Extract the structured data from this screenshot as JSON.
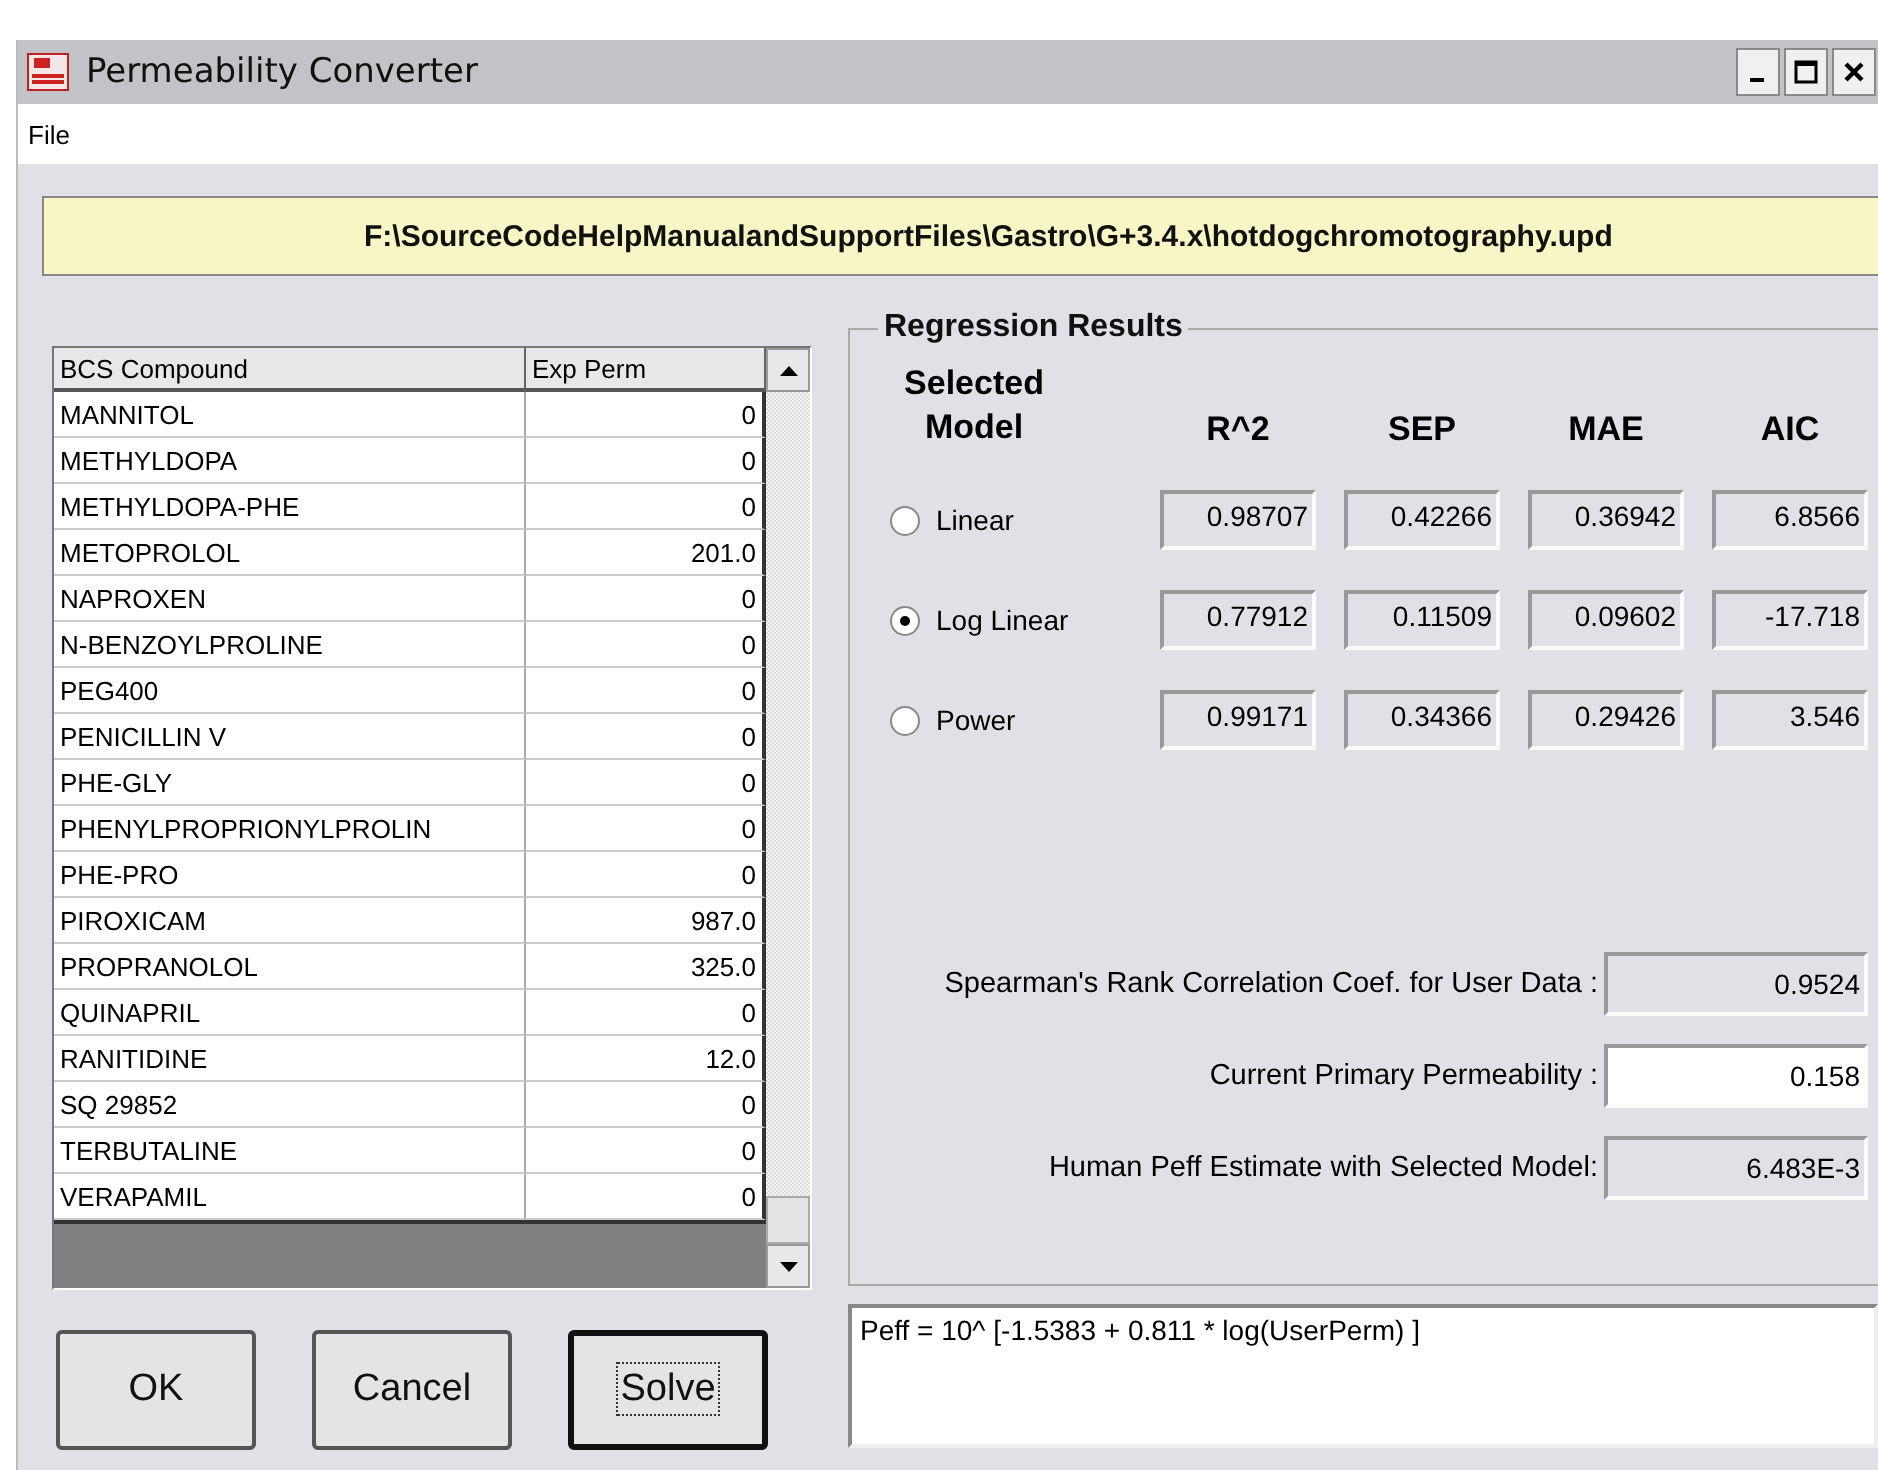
{
  "window": {
    "title": "Permeability Converter"
  },
  "menu": [
    "File"
  ],
  "file_path": "F:\\SourceCodeHelpManualandSupportFiles\\Gastro\\G+3.4.x\\hotdogchromotography.upd",
  "table": {
    "columns": [
      "BCS Compound",
      "Exp Perm"
    ],
    "rows": [
      [
        "MANNITOL",
        "0"
      ],
      [
        "METHYLDOPA",
        "0"
      ],
      [
        "METHYLDOPA-PHE",
        "0"
      ],
      [
        "METOPROLOL",
        "201.0"
      ],
      [
        "NAPROXEN",
        "0"
      ],
      [
        "N-BENZOYLPROLINE",
        "0"
      ],
      [
        "PEG400",
        "0"
      ],
      [
        "PENICILLIN V",
        "0"
      ],
      [
        "PHE-GLY",
        "0"
      ],
      [
        "PHENYLPROPRIONYLPROLIN",
        "0"
      ],
      [
        "PHE-PRO",
        "0"
      ],
      [
        "PIROXICAM",
        "987.0"
      ],
      [
        "PROPRANOLOL",
        "325.0"
      ],
      [
        "QUINAPRIL",
        "0"
      ],
      [
        "RANITIDINE",
        "12.0"
      ],
      [
        "SQ 29852",
        "0"
      ],
      [
        "TERBUTALINE",
        "0"
      ],
      [
        "VERAPAMIL",
        "0"
      ]
    ]
  },
  "regression": {
    "title": "Regression Results",
    "model_header": "Selected Model",
    "columns": [
      "R^2",
      "SEP",
      "MAE",
      "AIC"
    ],
    "models": [
      {
        "label": "Linear",
        "selected": false,
        "values": [
          "0.98707",
          "0.42266",
          "0.36942",
          "6.8566"
        ]
      },
      {
        "label": "Log Linear",
        "selected": true,
        "values": [
          "0.77912",
          "0.11509",
          "0.09602",
          "-17.718"
        ]
      },
      {
        "label": "Power",
        "selected": false,
        "values": [
          "0.99171",
          "0.34366",
          "0.29426",
          "3.546"
        ]
      }
    ],
    "fields": [
      {
        "label": "Spearman's Rank Correlation Coef. for User Data :",
        "value": "0.9524",
        "editable": false
      },
      {
        "label": "Current Primary Permeability :",
        "value": "0.158",
        "editable": true
      },
      {
        "label": "Human Peff Estimate with Selected Model:",
        "value": "6.483E-3",
        "editable": false
      }
    ]
  },
  "buttons": [
    {
      "label": "OK",
      "default": false
    },
    {
      "label": "Cancel",
      "default": false
    },
    {
      "label": "Solve",
      "default": true
    }
  ],
  "formula": "Peff = 10^ [-1.5383 + 0.811 * log(UserPerm) ]"
}
